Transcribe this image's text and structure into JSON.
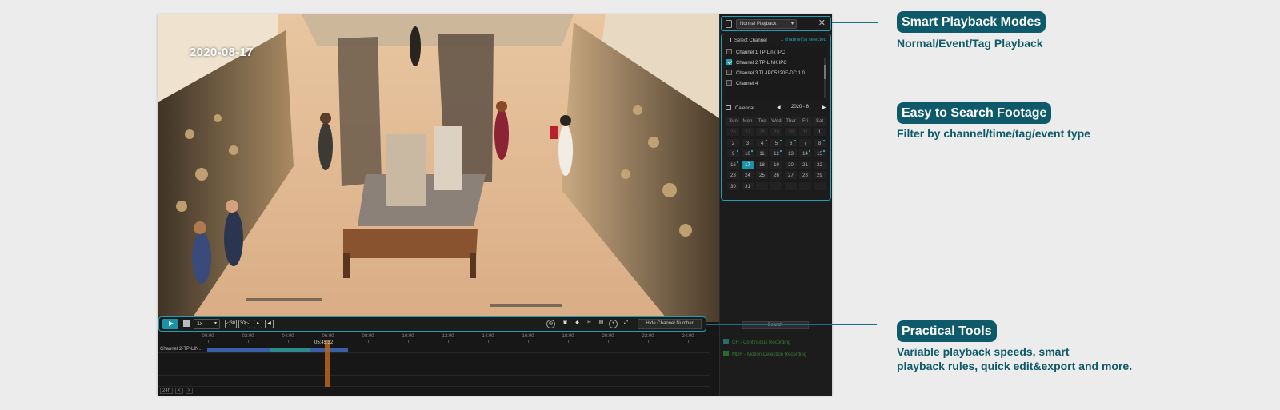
{
  "video": {
    "date_overlay": "2020-08-17"
  },
  "sidebar": {
    "mode_select": "Normal Playback",
    "close_icon": "close-icon",
    "select_channel_label": "Select Channel",
    "channels_selected": "1 channel(s) selected",
    "channels": [
      {
        "label": "Channel 1 TP-Link IPC",
        "checked": false
      },
      {
        "label": "Channel 2 TP-LINK IPC",
        "checked": true
      },
      {
        "label": "Channel 3 TL-IPC5220E-DC 1.0",
        "checked": false
      },
      {
        "label": "Channel 4",
        "checked": false
      }
    ],
    "calendar": {
      "label": "Calendar",
      "prev": "◀",
      "next": "▶",
      "month": "2020 - 8",
      "weekdays": [
        "Sun",
        "Mon",
        "Tue",
        "Wed",
        "Thur",
        "Fri",
        "Sat"
      ],
      "days": [
        {
          "d": "26",
          "dim": true
        },
        {
          "d": "27",
          "dim": true
        },
        {
          "d": "28",
          "dim": true
        },
        {
          "d": "29",
          "dim": true
        },
        {
          "d": "30",
          "dim": true
        },
        {
          "d": "31",
          "dim": true
        },
        {
          "d": "1"
        },
        {
          "d": "2"
        },
        {
          "d": "3"
        },
        {
          "d": "4",
          "rec": true
        },
        {
          "d": "5",
          "rec": true
        },
        {
          "d": "6",
          "rec": true
        },
        {
          "d": "7"
        },
        {
          "d": "8",
          "rec": true
        },
        {
          "d": "9",
          "rec": true
        },
        {
          "d": "10",
          "rec": true
        },
        {
          "d": "11"
        },
        {
          "d": "12",
          "rec": true
        },
        {
          "d": "13"
        },
        {
          "d": "14",
          "rec": true
        },
        {
          "d": "15",
          "rec": true
        },
        {
          "d": "16",
          "rec": true
        },
        {
          "d": "17",
          "selected": true
        },
        {
          "d": "18"
        },
        {
          "d": "19"
        },
        {
          "d": "20"
        },
        {
          "d": "21"
        },
        {
          "d": "22"
        },
        {
          "d": "23"
        },
        {
          "d": "24"
        },
        {
          "d": "25"
        },
        {
          "d": "26"
        },
        {
          "d": "27"
        },
        {
          "d": "28"
        },
        {
          "d": "29"
        },
        {
          "d": "30"
        },
        {
          "d": "31"
        },
        {
          "d": "",
          "dim": true
        },
        {
          "d": "",
          "dim": true
        },
        {
          "d": "",
          "dim": true
        },
        {
          "d": "",
          "dim": true
        },
        {
          "d": "",
          "dim": true
        }
      ]
    },
    "search_label": "Search",
    "legend": [
      {
        "label": "CR - Continuous Recording",
        "color": "#2a6a6a"
      },
      {
        "label": "MDR - Motion Detection Recording",
        "color": "#2a6a2a"
      }
    ]
  },
  "controls": {
    "speed": "1x",
    "back30": "◁30",
    "fwd30": "30▷",
    "hide_channel_number": "Hide Channel Number"
  },
  "timeline": {
    "ticks": [
      "00:00",
      "02:00",
      "04:00",
      "06:00",
      "08:00",
      "10:00",
      "12:00",
      "14:00",
      "16:00",
      "18:00",
      "20:00",
      "22:00",
      "24:00"
    ],
    "cursor_time": "05:45:32",
    "row_label": "Channel 2-TP-LIN...",
    "footer_zoom": "24h",
    "footer_prev": "<",
    "footer_next": ">"
  },
  "callouts": [
    {
      "title": "Smart Playback Modes",
      "subtitle": "Normal/Event/Tag Playback"
    },
    {
      "title": "Easy to Search Footage",
      "subtitle": "Filter by channel/time/tag/event type"
    },
    {
      "title": "Practical Tools",
      "subtitle_line1": "Variable playback speeds, smart",
      "subtitle_line2": "playback rules, quick edit&export and more."
    }
  ],
  "colors": {
    "accent": "#1fa0b4",
    "callout_bg": "#0e5a6a",
    "record_bar": "#3a5ea8",
    "cursor": "#b8651a"
  }
}
